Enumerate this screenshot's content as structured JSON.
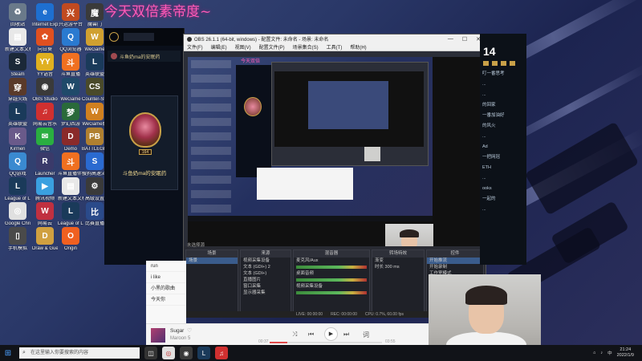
{
  "overlay": {
    "title": "今天双倍素帝度~"
  },
  "desktop_icons": [
    {
      "label": "回收站",
      "color": "#6a7a8a",
      "glyph": "♻",
      "name": "recycle-bin-icon"
    },
    {
      "label": "Internet Explorer",
      "color": "#1e6fd0",
      "glyph": "e",
      "name": "internet-explorer-icon"
    },
    {
      "label": "兴运游平台",
      "color": "#c04a20",
      "glyph": "兴",
      "name": "app-icon"
    },
    {
      "label": "魔兽门",
      "color": "#3a3a3a",
      "glyph": "魔",
      "name": "game-icon"
    },
    {
      "label": "新建文本文档",
      "color": "#e8e8e8",
      "glyph": "▤",
      "name": "text-document-icon"
    },
    {
      "label": "向日葵",
      "color": "#e05020",
      "glyph": "✿",
      "name": "sunflower-icon"
    },
    {
      "label": "QQ浏览器",
      "color": "#2a7ad0",
      "glyph": "Q",
      "name": "qq-browser-icon"
    },
    {
      "label": "WeGame",
      "color": "#d0a030",
      "glyph": "W",
      "name": "wegame-icon"
    },
    {
      "label": "Steam",
      "color": "#1b2838",
      "glyph": "S",
      "name": "steam-icon"
    },
    {
      "label": "YY语音",
      "color": "#e0b020",
      "glyph": "YY",
      "name": "yy-icon"
    },
    {
      "label": "斗鱼直播",
      "color": "#f07020",
      "glyph": "斗",
      "name": "douyu-icon"
    },
    {
      "label": "英雄联盟",
      "color": "#1a3a5a",
      "glyph": "L",
      "name": "lol-icon"
    },
    {
      "label": "穿越火线",
      "color": "#5a3a2a",
      "glyph": "穿",
      "name": "cf-icon"
    },
    {
      "label": "OBS Studio",
      "color": "#3a3a3a",
      "glyph": "◉",
      "name": "obs-icon"
    },
    {
      "label": "WeGame",
      "color": "#204a6a",
      "glyph": "W",
      "name": "wegame-icon"
    },
    {
      "label": "Counter-Strike",
      "color": "#4a4a2a",
      "glyph": "CS",
      "name": "csgo-icon"
    },
    {
      "label": "英雄联盟",
      "color": "#1a3a5a",
      "glyph": "L",
      "name": "lol-icon"
    },
    {
      "label": "网易云音乐",
      "color": "#d03030",
      "glyph": "♫",
      "name": "netease-music-icon"
    },
    {
      "label": "梦幻西游",
      "color": "#2a6a3a",
      "glyph": "梦",
      "name": "game-icon"
    },
    {
      "label": "WeGame版",
      "color": "#d08020",
      "glyph": "W",
      "name": "wegame-icon"
    },
    {
      "label": "Kirmeri",
      "color": "#6a5a8a",
      "glyph": "K",
      "name": "app-icon"
    },
    {
      "label": "微信",
      "color": "#2aae40",
      "glyph": "✉",
      "name": "wechat-icon"
    },
    {
      "label": "Demo",
      "color": "#8a2a2a",
      "glyph": "D",
      "name": "app-icon"
    },
    {
      "label": "BATTLEGROUNDS",
      "color": "#b08030",
      "glyph": "PB",
      "name": "pubg-icon"
    },
    {
      "label": "QQ游戏",
      "color": "#3a8ad0",
      "glyph": "Q",
      "name": "qq-game-icon"
    },
    {
      "label": "Launcher",
      "color": "#3a3a6a",
      "glyph": "R",
      "name": "launcher-icon"
    },
    {
      "label": "斗鱼直播伴侣",
      "color": "#f07020",
      "glyph": "斗",
      "name": "douyu-icon"
    },
    {
      "label": "搜狗高速浏览器",
      "color": "#2a6ad0",
      "glyph": "S",
      "name": "sogou-icon"
    },
    {
      "label": "League of Legends",
      "color": "#1a3a5a",
      "glyph": "L",
      "name": "lol-icon"
    },
    {
      "label": "腾讯视频",
      "color": "#3aa0e0",
      "glyph": "▶",
      "name": "video-icon"
    },
    {
      "label": "新建文本文档",
      "color": "#e8e8e8",
      "glyph": "▤",
      "name": "text-document-icon"
    },
    {
      "label": "高级设置",
      "color": "#3a3a3a",
      "glyph": "⚙",
      "name": "gear-icon"
    },
    {
      "label": "Google Chrome",
      "color": "#e0e0e0",
      "glyph": "◎",
      "name": "chrome-icon"
    },
    {
      "label": "网易云",
      "color": "#c03040",
      "glyph": "W",
      "name": "app-icon"
    },
    {
      "label": "League of Legends",
      "color": "#1a3a5a",
      "glyph": "L",
      "name": "lol-icon"
    },
    {
      "label": "比赛直播",
      "color": "#2a4a8a",
      "glyph": "比",
      "name": "app-icon"
    },
    {
      "label": "手机模拟",
      "color": "#4a4a4a",
      "glyph": "▯",
      "name": "app-icon"
    },
    {
      "label": "Draw & Guess",
      "color": "#d0a040",
      "glyph": "D",
      "name": "game-icon"
    },
    {
      "label": "Origin",
      "color": "#f06020",
      "glyph": "O",
      "name": "origin-icon"
    }
  ],
  "lol_client": {
    "summoner_name": "斗鱼奶ma的安眠药",
    "level": "164",
    "title_row": "斗鱼奶ma的安眠药"
  },
  "obs": {
    "title": "OBS 26.1.1 (64-bit, windows) - 配置文件: 未命名 - 场景: 未命名",
    "menu": [
      "文件(F)",
      "编辑(E)",
      "视图(V)",
      "配置文件(P)",
      "场景集合(S)",
      "工具(T)",
      "帮助(H)"
    ],
    "source_label": "未选择源",
    "panels": {
      "scenes": {
        "title": "场景",
        "items": [
          "场景"
        ]
      },
      "sources": {
        "title": "来源",
        "items": [
          "视频采集设备",
          "文本 (GDI+) 2",
          "文本 (GDI+)",
          "直播图片",
          "窗口采集",
          "显示器采集"
        ]
      },
      "mixer": {
        "title": "混音器",
        "items": [
          "麦克风/Aux",
          "桌面音频",
          "视频采集设备"
        ]
      },
      "transitions": {
        "title": "转场特效",
        "items": [
          "渐变",
          "时长 300 ms"
        ]
      },
      "controls": {
        "title": "控件",
        "items": [
          "开始推流",
          "开始录制",
          "工作室模式",
          "设置",
          "退出"
        ]
      }
    },
    "statusbar": {
      "live": "LIVE: 00:00:00",
      "rec": "REC: 00:00:00",
      "cpu": "CPU: 0.7%, 60.00 fps"
    }
  },
  "chat": {
    "big": "14",
    "lines": [
      "叮一番思考",
      "...",
      "...",
      "的回家",
      "一番加油好",
      "的风火",
      "...",
      "Ad",
      "一把网冠",
      "ETH",
      "...",
      "ooks",
      "一起的",
      "..."
    ]
  },
  "music": {
    "playlist": [
      "run",
      "i like",
      "小黑的歌曲",
      "今天你"
    ],
    "song": "Sugar",
    "artist": "Maroon 5",
    "time_current": "00:37",
    "time_total": "03:55",
    "progress": 0.16
  },
  "taskbar": {
    "search_placeholder": "在这里输入你要搜索的内容",
    "time": "21:24",
    "date": "2022/1/9",
    "lang": "中"
  }
}
